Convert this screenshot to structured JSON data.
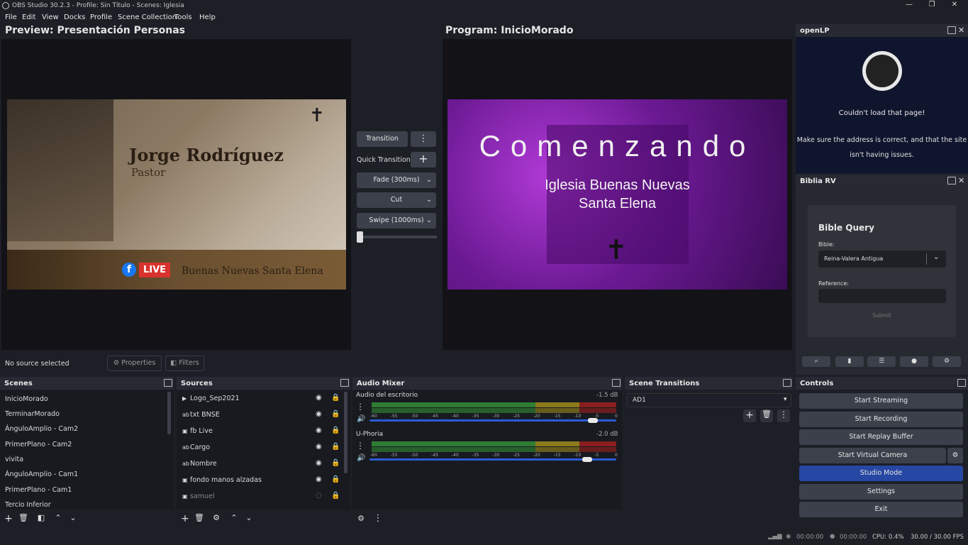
{
  "window": {
    "title": "OBS Studio 30.2.3 - Profile: Sin Título - Scenes: Iglesia"
  },
  "menu": [
    "File",
    "Edit",
    "View",
    "Docks",
    "Profile",
    "Scene Collection",
    "Tools",
    "Help"
  ],
  "preview": {
    "title": "Preview: Presentación Personas",
    "name": "Jorge Rodríguez",
    "role": "Pastor",
    "live": "LIVE",
    "footer": "Buenas Nuevas Santa Elena"
  },
  "program": {
    "title": "Program: InicioMorado",
    "heading": "Comenzando",
    "line1": "Iglesia Buenas Nuevas",
    "line2": "Santa Elena"
  },
  "transitions": {
    "transition": "Transition",
    "quick": "Quick Transitions",
    "fade": "Fade (300ms)",
    "cut": "Cut",
    "swipe": "Swipe (1000ms)"
  },
  "sourcebar": {
    "status": "No source selected",
    "properties": "Properties",
    "filters": "Filters"
  },
  "openlp": {
    "title": "openLP",
    "line1": "Couldn't load that page!",
    "line2": "Make sure the address is correct, and that the site",
    "line3": "isn't having issues."
  },
  "biblia": {
    "title": "Biblia RV",
    "heading": "Bible Query",
    "bible_label": "Bible:",
    "bible_value": "Reina-Valera Antigua",
    "reference_label": "Reference:",
    "submit": "Submit"
  },
  "scenes": {
    "title": "Scenes",
    "items": [
      "InicioMorado",
      "TerminarMorado",
      "ÁnguloAmplio - Cam2",
      "PrimerPlano - Cam2",
      "vivita",
      "ÁnguloAmplio - Cam1",
      "PrimerPlano - Cam1",
      "Tercio Inferior"
    ]
  },
  "sources": {
    "title": "Sources",
    "items": [
      {
        "icon": "▶",
        "name": "Logo_Sep2021"
      },
      {
        "icon": "ab",
        "name": "txt BNSE"
      },
      {
        "icon": "▣",
        "name": "fb Live"
      },
      {
        "icon": "ab",
        "name": "Cargo"
      },
      {
        "icon": "ab",
        "name": "Nombre"
      },
      {
        "icon": "▣",
        "name": "fondo manos alzadas"
      },
      {
        "icon": "▣",
        "name": "samuel"
      }
    ]
  },
  "mixer": {
    "title": "Audio Mixer",
    "channels": [
      {
        "name": "Audio del escritorio",
        "db": "-1.5 dB",
        "level": 0.905
      },
      {
        "name": "U-Phoria",
        "db": "-2.0 dB",
        "level": 0.882
      }
    ],
    "scale": [
      "-60",
      "-55",
      "-50",
      "-45",
      "-40",
      "-35",
      "-30",
      "-25",
      "-20",
      "-15",
      "-10",
      "-5",
      "0"
    ]
  },
  "scene_transitions": {
    "title": "Scene Transitions",
    "value": "AD1"
  },
  "controls": {
    "title": "Controls",
    "buttons": [
      "Start Streaming",
      "Start Recording",
      "Start Replay Buffer",
      "Start Virtual Camera",
      "Studio Mode",
      "Settings",
      "Exit"
    ]
  },
  "statusbar": {
    "live_time": "00:00:00",
    "rec_time": "00:00:00",
    "cpu": "CPU: 0.4%",
    "fps": "30.00 / 30.00 FPS"
  },
  "colors": {
    "accent": "#2a5bd6",
    "studio_mode": "#2647a3",
    "live_red": "#d9322e",
    "purple": "#8a1fb5"
  }
}
